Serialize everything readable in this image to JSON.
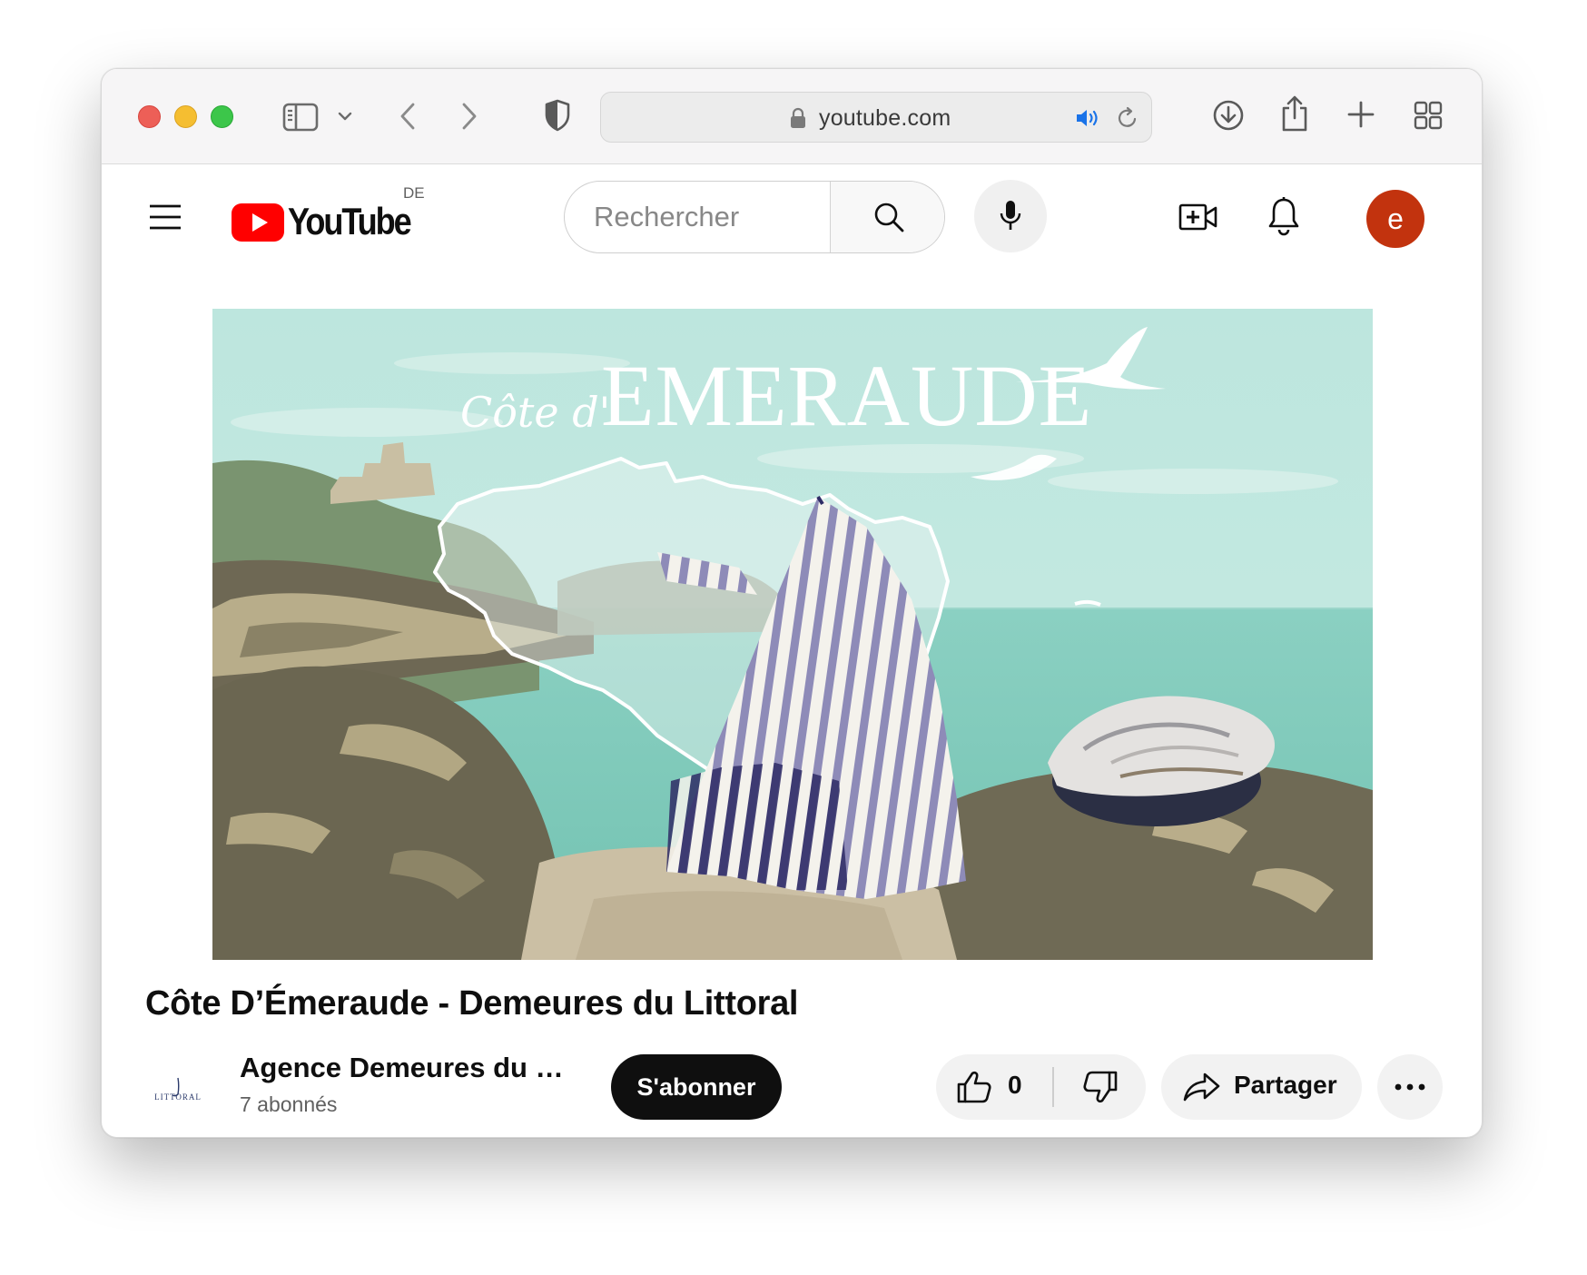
{
  "browser": {
    "url": "youtube.com"
  },
  "youtube": {
    "logo_text": "YouTube",
    "region": "DE",
    "search_placeholder": "Rechercher",
    "avatar_letter": "e",
    "avatar_color": "#c2330e"
  },
  "thumbnail": {
    "script_text": "Côte d'",
    "title_text": "EMERAUDE"
  },
  "video": {
    "title": "Côte D’Émeraude - Demeures du Littoral",
    "channel_name": "Agence Demeures du Littoral",
    "channel_logo_text": "LITTORAL",
    "subscribers": "7 abonnés",
    "subscribe_label": "S'abonner",
    "likes": "0",
    "share_label": "Partager"
  },
  "colors": {
    "youtube_red": "#ff0000",
    "subscribe_bg": "#0f0f0f",
    "sky": "#b9e4dc",
    "sea": "#7fcbbb",
    "rock": "#6f6a55",
    "tent_stripe": "#8f8cb6"
  }
}
